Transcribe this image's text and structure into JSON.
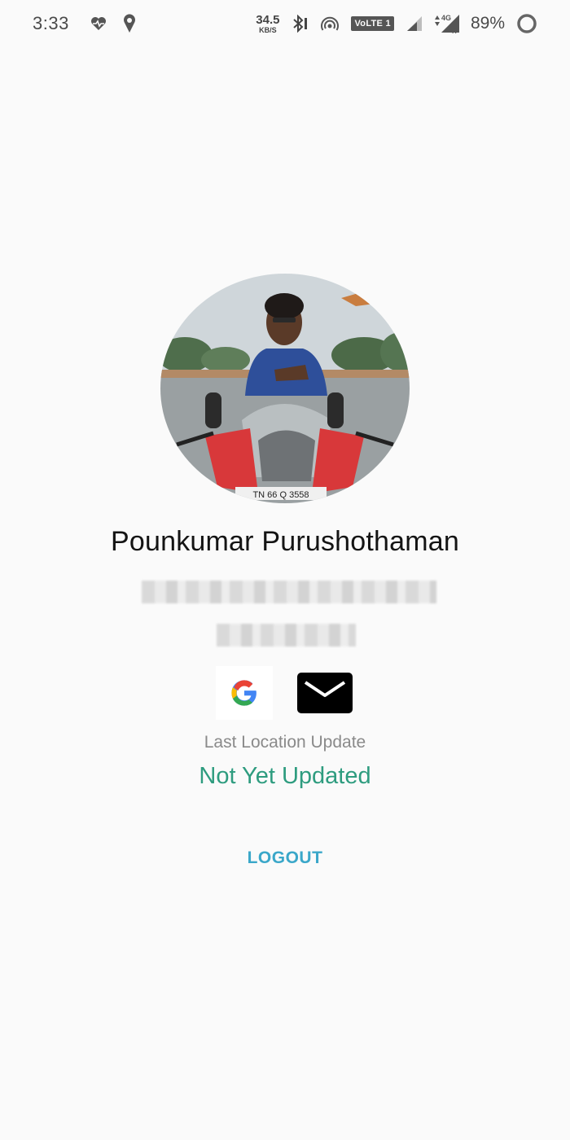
{
  "status_bar": {
    "time": "3:33",
    "left_icons": [
      "heart-pulse-icon",
      "location-pin-icon"
    ],
    "net_speed_value": "34.5",
    "net_speed_unit": "KB/S",
    "volte_label": "VoLTE 1",
    "network_type": "4G",
    "battery_percent": "89%",
    "right_icons": [
      "bluetooth-icon",
      "hotspot-icon",
      "signal-icon",
      "signal-4g-icon",
      "battery-ring-icon"
    ]
  },
  "profile": {
    "avatar_icon": "profile-photo",
    "name": "Pounkumar Purushothaman",
    "email_redacted": "",
    "phone_redacted": ""
  },
  "social": {
    "google_icon": "google-icon",
    "mail_icon": "mail-icon",
    "google_color_blue": "#4285F4",
    "google_color_red": "#EA4335",
    "google_color_yellow": "#FBBC05",
    "google_color_green": "#34A853"
  },
  "location": {
    "label": "Last Location Update",
    "value": "Not Yet Updated",
    "value_color": "#2e9c7f"
  },
  "actions": {
    "logout_label": "LOGOUT",
    "logout_color": "#3aa7c9"
  }
}
